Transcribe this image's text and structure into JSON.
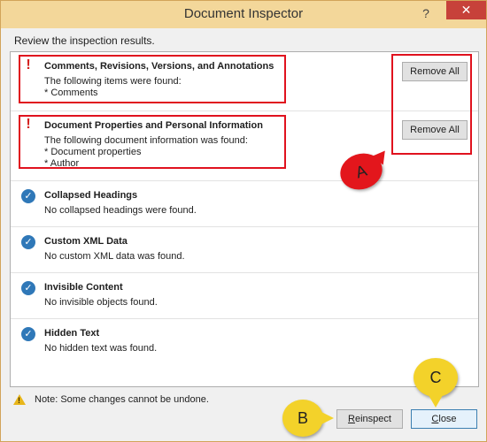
{
  "window": {
    "title": "Document Inspector",
    "help_label": "?",
    "close_label": "✕"
  },
  "subtitle": "Review the inspection results.",
  "items": [
    {
      "heading": "Comments, Revisions, Versions, and Annotations",
      "description": "The following items were found:\n* Comments",
      "status": "warning",
      "icon": "exclamation-icon",
      "action_label": "Remove All"
    },
    {
      "heading": "Document Properties and Personal Information",
      "description": "The following document information was found:\n* Document properties\n* Author",
      "status": "warning",
      "icon": "exclamation-icon",
      "action_label": "Remove All"
    },
    {
      "heading": "Collapsed Headings",
      "description": "No collapsed headings were found.",
      "status": "ok",
      "icon": "checkmark-icon"
    },
    {
      "heading": "Custom XML Data",
      "description": "No custom XML data was found.",
      "status": "ok",
      "icon": "checkmark-icon"
    },
    {
      "heading": "Invisible Content",
      "description": "No invisible objects found.",
      "status": "ok",
      "icon": "checkmark-icon"
    },
    {
      "heading": "Hidden Text",
      "description": "No hidden text was found.",
      "status": "ok",
      "icon": "checkmark-icon"
    }
  ],
  "icons": {
    "warning_glyph": "!",
    "ok_glyph": "✓"
  },
  "note": {
    "icon": "warning-triangle-icon",
    "glyph": "!",
    "text": "Note: Some changes cannot be undone."
  },
  "buttons": {
    "reinspect_first": "R",
    "reinspect_rest": "einspect",
    "close_first": "C",
    "close_rest": "lose"
  },
  "callouts": {
    "a": "A",
    "b": "B",
    "c": "C"
  },
  "colors": {
    "titlebar": "#f3d79a",
    "close_button": "#c7413a",
    "warning": "#d4211f",
    "ok": "#2f78b8",
    "highlight": "#e0121e",
    "callout_yellow": "#f3d22a"
  }
}
